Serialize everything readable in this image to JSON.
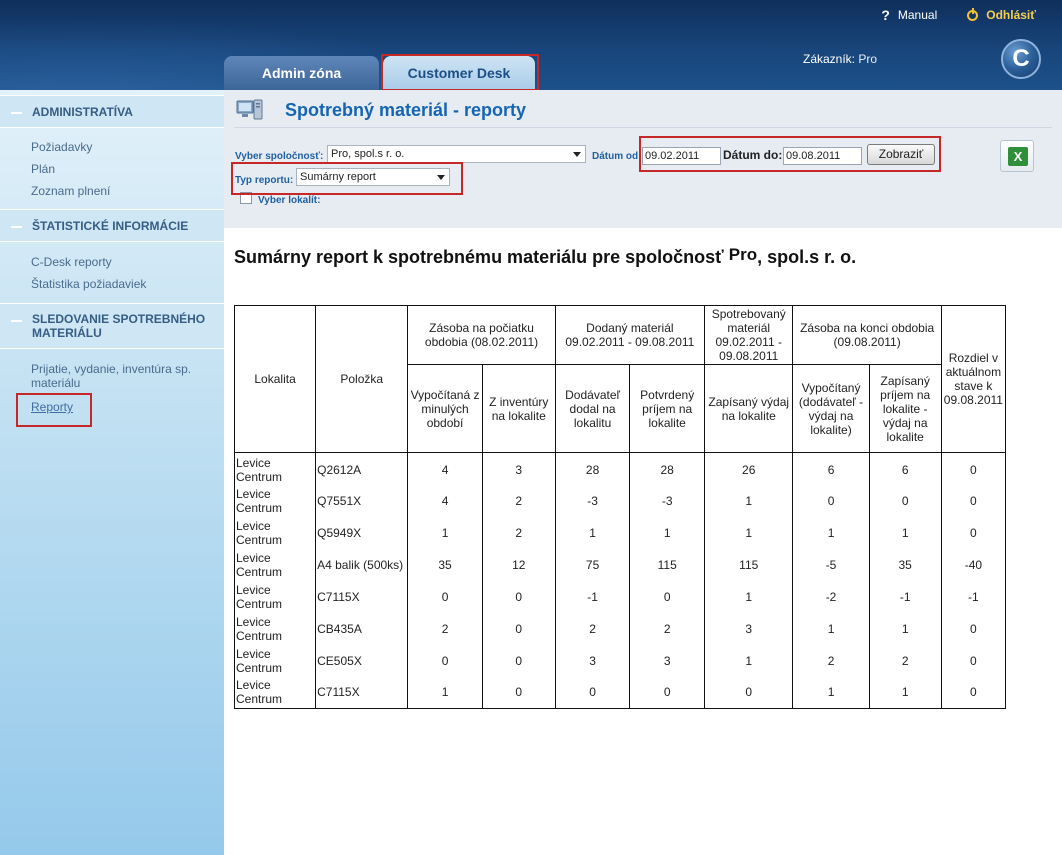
{
  "top_links": {
    "manual": "Manual",
    "logout": "Odhlásiť"
  },
  "customer": {
    "label": "Zákazník:",
    "name": "Pro"
  },
  "logo_letter": "C",
  "tabs": [
    {
      "label": "Admin zóna",
      "active": false
    },
    {
      "label": "Customer Desk",
      "active": true
    }
  ],
  "sidebar": {
    "sections": [
      {
        "title": "ADMINISTRATÍVA",
        "items": [
          "Požiadavky",
          "Plán",
          "Zoznam plnení"
        ]
      },
      {
        "title": "ŠTATISTICKÉ INFORMÁCIE",
        "items": [
          "C-Desk reporty",
          "Štatistika požiadaviek"
        ]
      },
      {
        "title": "SLEDOVANIE SPOTREBNÉHO MATERIÁLU",
        "items": [
          "Prijatie, vydanie, inventúra sp. materiálu",
          "Reporty"
        ]
      }
    ],
    "active_item": "Reporty"
  },
  "page": {
    "title": "Spotrebný materiál - reporty"
  },
  "filters": {
    "company_label": "Vyber spoločnosť:",
    "company_value": "Pro, spol.s r. o.",
    "date_from_label": "Dátum od:",
    "date_from_value": "09.02.2011",
    "date_to_label": "Dátum do:",
    "date_to_value": "09.08.2011",
    "show_button": "Zobraziť",
    "report_type_label": "Typ reportu:",
    "report_type_value": "Sumárny report",
    "location_label": "Vyber lokalít:",
    "location_checked": false,
    "excel_icon": "excel-export-icon"
  },
  "report": {
    "title_prefix": "Sumárny report k spotrebnému materiálu pre spoločnosť",
    "title_company": "Pro",
    "title_suffix": ", spol.s r. o.",
    "headers": {
      "lokalita": "Lokalita",
      "polozka": "Položka",
      "zasoba_start": "Zásoba na počiatku obdobia (08.02.2011)",
      "dodany": "Dodaný materiál 09.02.2011 - 09.08.2011",
      "spotrebovany": "Spotrebovaný materiál 09.02.2011 - 09.08.2011",
      "zasoba_end": "Zásoba na konci obdobia (09.08.2011)",
      "rozdiel": "Rozdiel v aktuálnom stave k 09.08.2011",
      "vypocitana": "Vypočítaná z minulých období",
      "z_inventury": "Z inventúry na lokalite",
      "dodavatel_dodal": "Dodávateľ dodal na lokalitu",
      "potvrdeny_prijem": "Potvrdený príjem na lokalite",
      "zapisany_vydaj": "Zapísaný výdaj na lokalite",
      "vypocitany": "Vypočítaný (dodávateľ - výdaj na lokalite)",
      "zapisany_prijem": "Zapísaný príjem na lokalite - výdaj na lokalite"
    },
    "rows": [
      {
        "loc": "Levice Centrum",
        "item": "Q2612A",
        "v": [
          "4",
          "3",
          "28",
          "28",
          "26",
          "6",
          "6",
          "0"
        ]
      },
      {
        "loc": "Levice Centrum",
        "item": "Q7551X",
        "v": [
          "4",
          "2",
          "-3",
          "-3",
          "1",
          "0",
          "0",
          "0"
        ]
      },
      {
        "loc": "Levice Centrum",
        "item": "Q5949X",
        "v": [
          "1",
          "2",
          "1",
          "1",
          "1",
          "1",
          "1",
          "0"
        ]
      },
      {
        "loc": "Levice Centrum",
        "item": "A4 balik (500ks)",
        "v": [
          "35",
          "12",
          "75",
          "115",
          "115",
          "-5",
          "35",
          "-40"
        ]
      },
      {
        "loc": "Levice Centrum",
        "item": "C7115X",
        "v": [
          "0",
          "0",
          "-1",
          "0",
          "1",
          "-2",
          "-1",
          "-1"
        ]
      },
      {
        "loc": "Levice Centrum",
        "item": "CB435A",
        "v": [
          "2",
          "0",
          "2",
          "2",
          "3",
          "1",
          "1",
          "0"
        ]
      },
      {
        "loc": "Levice Centrum",
        "item": "CE505X",
        "v": [
          "0",
          "0",
          "3",
          "3",
          "1",
          "2",
          "2",
          "0"
        ]
      },
      {
        "loc": "Levice Centrum",
        "item": "C7115X",
        "v": [
          "1",
          "0",
          "0",
          "0",
          "0",
          "1",
          "1",
          "0"
        ]
      }
    ]
  }
}
